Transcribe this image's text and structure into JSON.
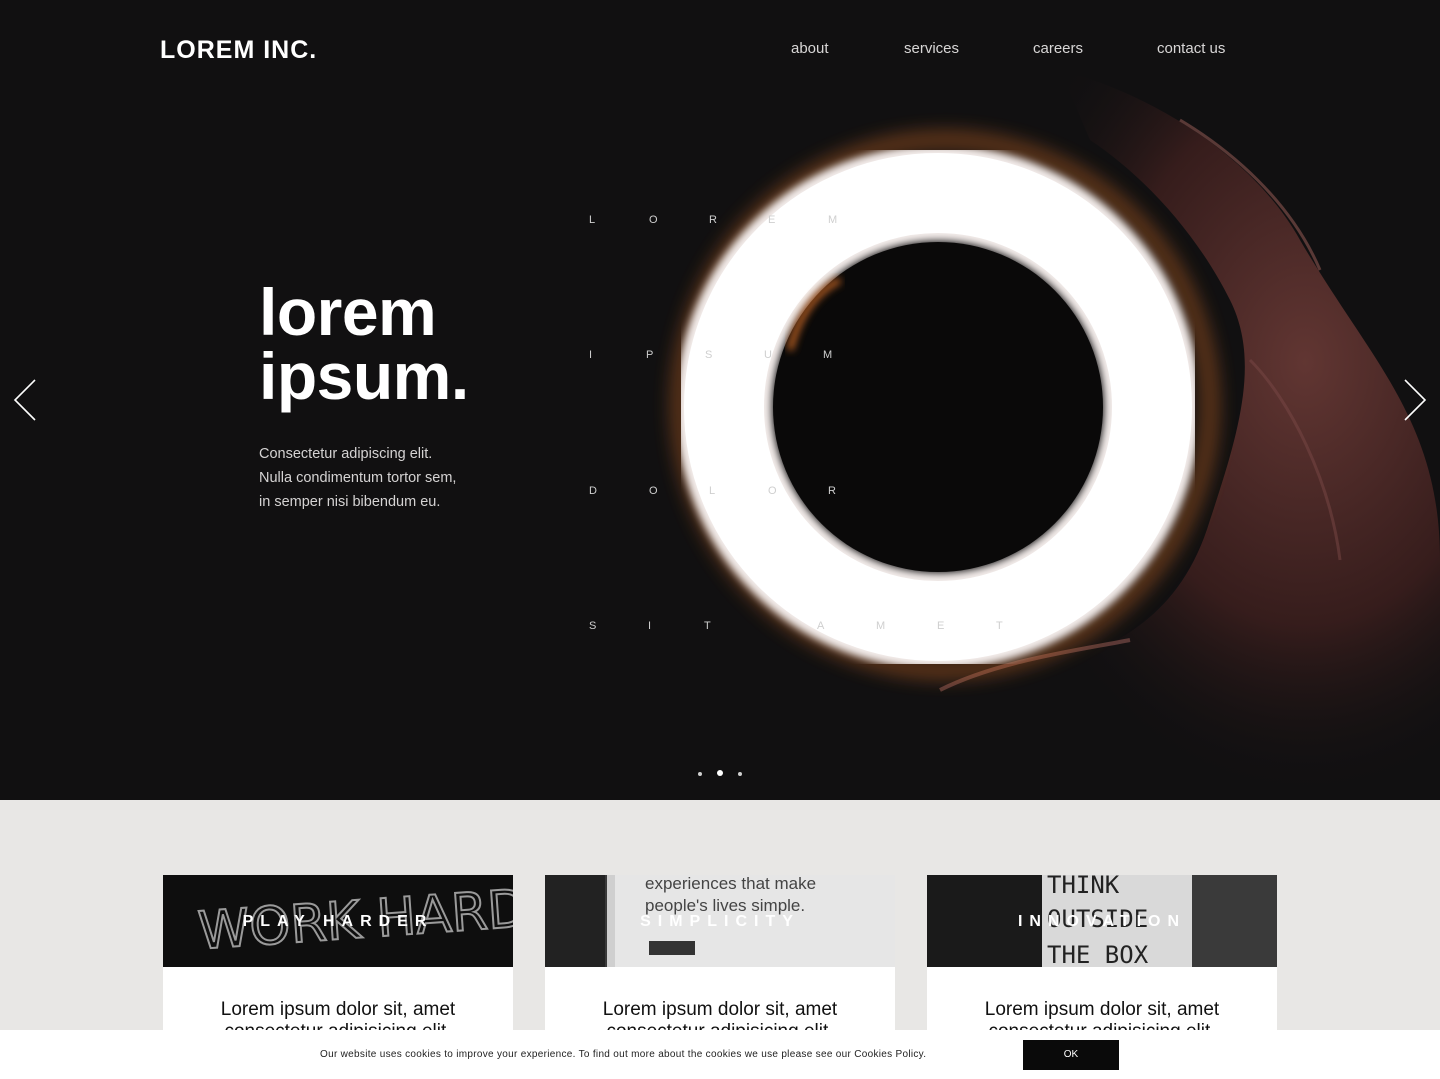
{
  "header": {
    "logo": "LOREM INC.",
    "nav": [
      "about",
      "services",
      "careers",
      "contact us"
    ]
  },
  "hero": {
    "headline": [
      "lorem",
      "ipsum."
    ],
    "subtext": [
      "Consectetur adipiscing elit.",
      "Nulla condimentum tortor sem,",
      "in semper nisi bibendum eu."
    ],
    "spaced_words": {
      "row1": [
        "L",
        "O",
        "R",
        "E",
        "M"
      ],
      "row2": [
        "I",
        "P",
        "S",
        "U",
        "M"
      ],
      "row3": [
        "D",
        "O",
        "L",
        "O",
        "R"
      ],
      "row4": [
        "S",
        "I",
        "T",
        "A",
        "M",
        "E",
        "T"
      ]
    },
    "prev_icon": "chevron-left-icon",
    "next_icon": "chevron-right-icon",
    "slides": 3,
    "active_slide": 2
  },
  "cards": [
    {
      "title": "PLAY HARDER",
      "body": [
        "Lorem ipsum dolor sit, amet",
        "consectetur adipisicing elit."
      ],
      "image_text": "WORK HARDER"
    },
    {
      "title": "SIMPLICITY",
      "body": [
        "Lorem ipsum dolor sit, amet",
        "consectetur adipisicing elit."
      ],
      "image_text": [
        "experiences that make",
        "people's lives simple."
      ]
    },
    {
      "title": "INNOVATION",
      "body": [
        "Lorem ipsum dolor sit, amet",
        "consectetur adipisicing elit."
      ],
      "image_text": [
        "THINK",
        "OUTSIDE",
        "THE BOX"
      ]
    }
  ],
  "cookie": {
    "text": "Our website uses cookies to improve your experience. To find out more about the cookies we use please see our Cookies Policy.",
    "button": "OK"
  },
  "colors": {
    "hero_bg": "#111011",
    "section_bg": "#e8e7e5",
    "ring_glow": "#fbf6f4",
    "accent_orange": "#e8772a"
  }
}
